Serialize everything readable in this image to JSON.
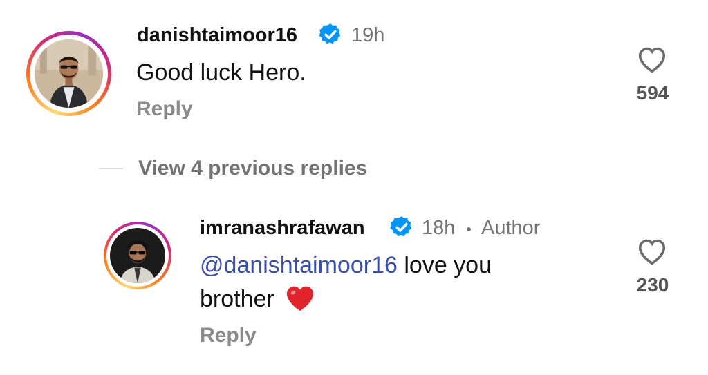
{
  "comments": [
    {
      "username": "danishtaimoor16",
      "time": "19h",
      "text": "Good luck Hero.",
      "reply_label": "Reply",
      "likes": "594"
    }
  ],
  "view_replies": "View 4 previous replies",
  "reply": {
    "username": "imranashrafawan",
    "time": "18h",
    "author_tag": "Author",
    "mention": "@danishtaimoor16",
    "text_line1": " love you",
    "text_line2": "brother",
    "reply_label": "Reply",
    "likes": "230"
  },
  "colors": {
    "verified_badge": "#0095f6",
    "mention": "#3b4fa8",
    "heart_emoji": "#e0242c"
  }
}
